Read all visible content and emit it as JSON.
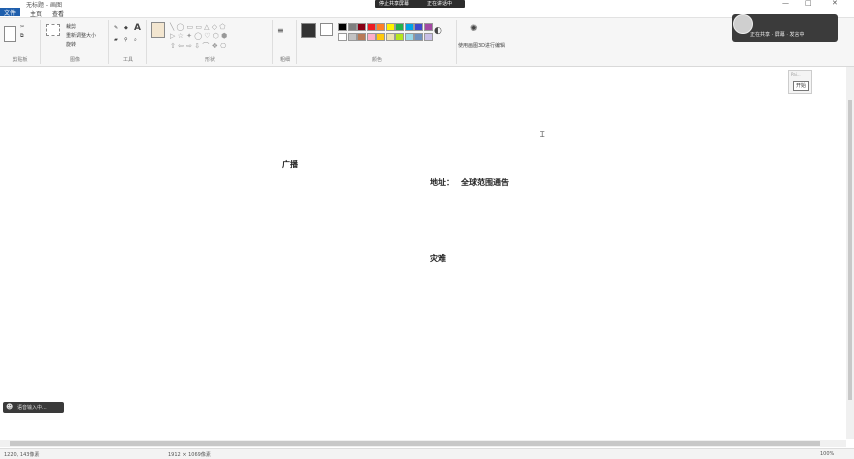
{
  "window": {
    "title": "无标题 - 画图",
    "controls": [
      "—",
      "□",
      "✕"
    ]
  },
  "tabs": [
    {
      "label": "文件"
    },
    {
      "label": "主页"
    },
    {
      "label": "查看"
    }
  ],
  "ribbon": {
    "groups": [
      {
        "label": "剪贴板"
      },
      {
        "label": "图像"
      },
      {
        "label": "工具"
      },
      {
        "label": "形状"
      },
      {
        "label": "粗细"
      },
      {
        "label": "颜色"
      }
    ],
    "image_buttons": [
      "裁剪",
      "重新调整大小",
      "旋转"
    ],
    "edit_colors_label": "编辑颜色",
    "paint3d_label": "使用画图3D进行编辑",
    "palette": [
      "#000000",
      "#7f7f7f",
      "#880015",
      "#ed1c24",
      "#ff7f27",
      "#fff200",
      "#22b14c",
      "#00a2e8",
      "#3f48cc",
      "#a349a4",
      "#ffffff",
      "#c3c3c3",
      "#b97a57",
      "#ffaec9",
      "#ffc90e",
      "#efe4b0",
      "#b5e61d",
      "#99d9ea",
      "#7092be",
      "#c8bfe7"
    ]
  },
  "notify": {
    "left_text": "停止共享屏幕",
    "right_text": "正在讲话中"
  },
  "right_panel": {
    "text": "正在共享 · 屏幕 · 发言中"
  },
  "canvas": {
    "label_broadcast": "广播",
    "label_address": "地址：",
    "label_address_value": "全球范围通告",
    "label_disaster": "灾难"
  },
  "mini_window": {
    "title": "Pai...",
    "button": "开始"
  },
  "voice_bar": {
    "text": "语音输入中..."
  },
  "status": {
    "cursor_pos": "1220, 143像素",
    "canvas_size": "1912 × 1069像素",
    "zoom": "100%"
  }
}
